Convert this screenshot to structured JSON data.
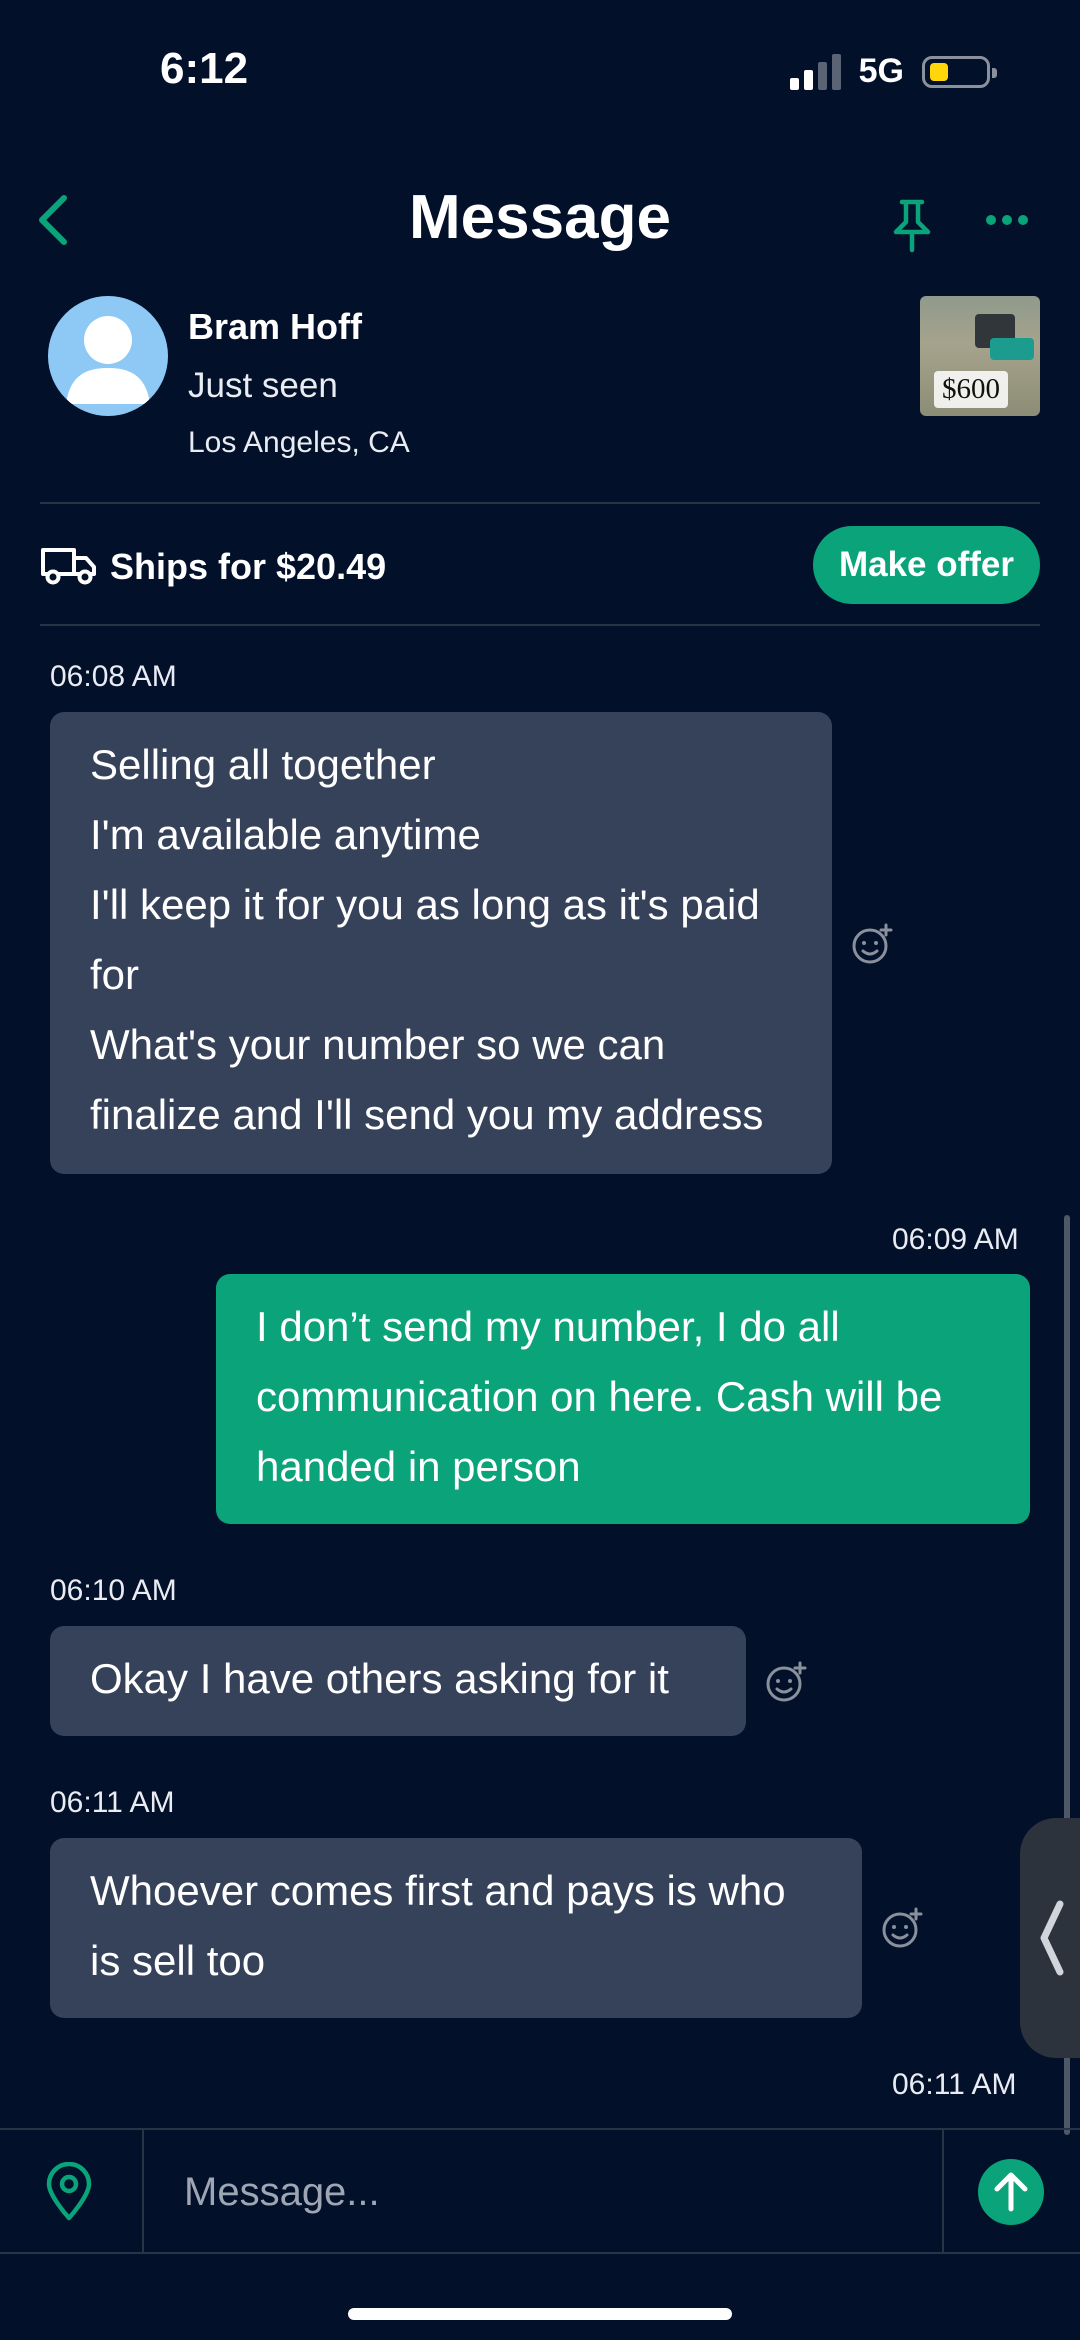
{
  "status_bar": {
    "time": "6:12",
    "network": "5G"
  },
  "header": {
    "title": "Message"
  },
  "seller": {
    "name": "Bram Hoff",
    "status": "Just seen",
    "location": "Los Angeles, CA"
  },
  "item": {
    "price": "$600"
  },
  "shipping": {
    "text": "Ships for $20.49",
    "offer_label": "Make offer"
  },
  "messages": [
    {
      "time": "06:08 AM",
      "side": "in",
      "lines": [
        "Selling all together",
        "I'm available anytime",
        "I'll keep it for you as long as it's paid",
        "for",
        "What's your number so we can",
        "finalize and I'll send you my address"
      ]
    },
    {
      "time": "06:09 AM",
      "side": "out",
      "lines": [
        "I don’t send my number, I do all",
        "communication on here.  Cash will be",
        "handed in person"
      ]
    },
    {
      "time": "06:10 AM",
      "side": "in",
      "lines": [
        "Okay I have others asking for it"
      ]
    },
    {
      "time": "06:11 AM",
      "side": "in",
      "lines": [
        "Whoever comes first and pays is who",
        "is sell too"
      ]
    },
    {
      "time": "06:11 AM",
      "side": "out",
      "lines": []
    }
  ],
  "composer": {
    "placeholder": "Message..."
  },
  "colors": {
    "background": "#02102a",
    "accent": "#0aa37a",
    "incoming_bubble": "#36415a"
  }
}
